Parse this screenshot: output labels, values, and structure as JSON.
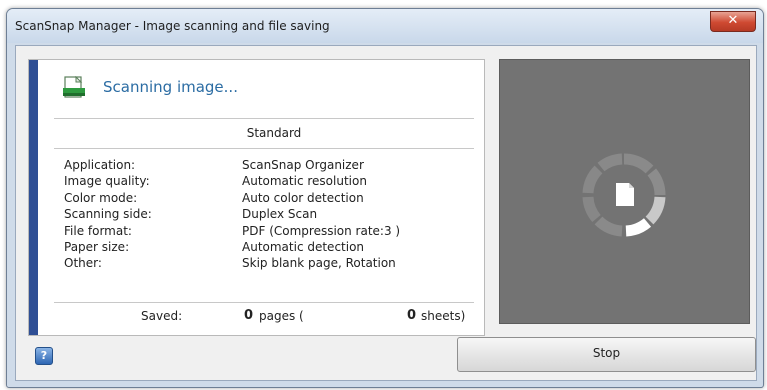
{
  "window": {
    "title": "ScanSnap Manager - Image scanning and file saving",
    "close_glyph": "✕"
  },
  "status": {
    "text": "Scanning image...",
    "icon": "scanner-document-icon"
  },
  "mode": "Standard",
  "details": [
    {
      "label": "Application:",
      "value": "ScanSnap Organizer"
    },
    {
      "label": "Image quality:",
      "value": "Automatic resolution"
    },
    {
      "label": "Color mode:",
      "value": "Auto color detection"
    },
    {
      "label": "Scanning side:",
      "value": "Duplex Scan"
    },
    {
      "label": "File format:",
      "value": "PDF (Compression rate:3 )"
    },
    {
      "label": "Paper size:",
      "value": "Automatic detection"
    },
    {
      "label": "Other:",
      "value": "Skip blank page, Rotation"
    }
  ],
  "saved": {
    "label": "Saved:",
    "pages_count": "0",
    "pages_label": "pages (",
    "sheets_count": "0",
    "sheets_label": "sheets)"
  },
  "buttons": {
    "stop": "Stop",
    "help_glyph": "?"
  },
  "colors": {
    "accent": "#2f4f95",
    "status_text": "#2b6ca3",
    "preview_bg": "#737373",
    "close_button": "#cf4a32"
  }
}
